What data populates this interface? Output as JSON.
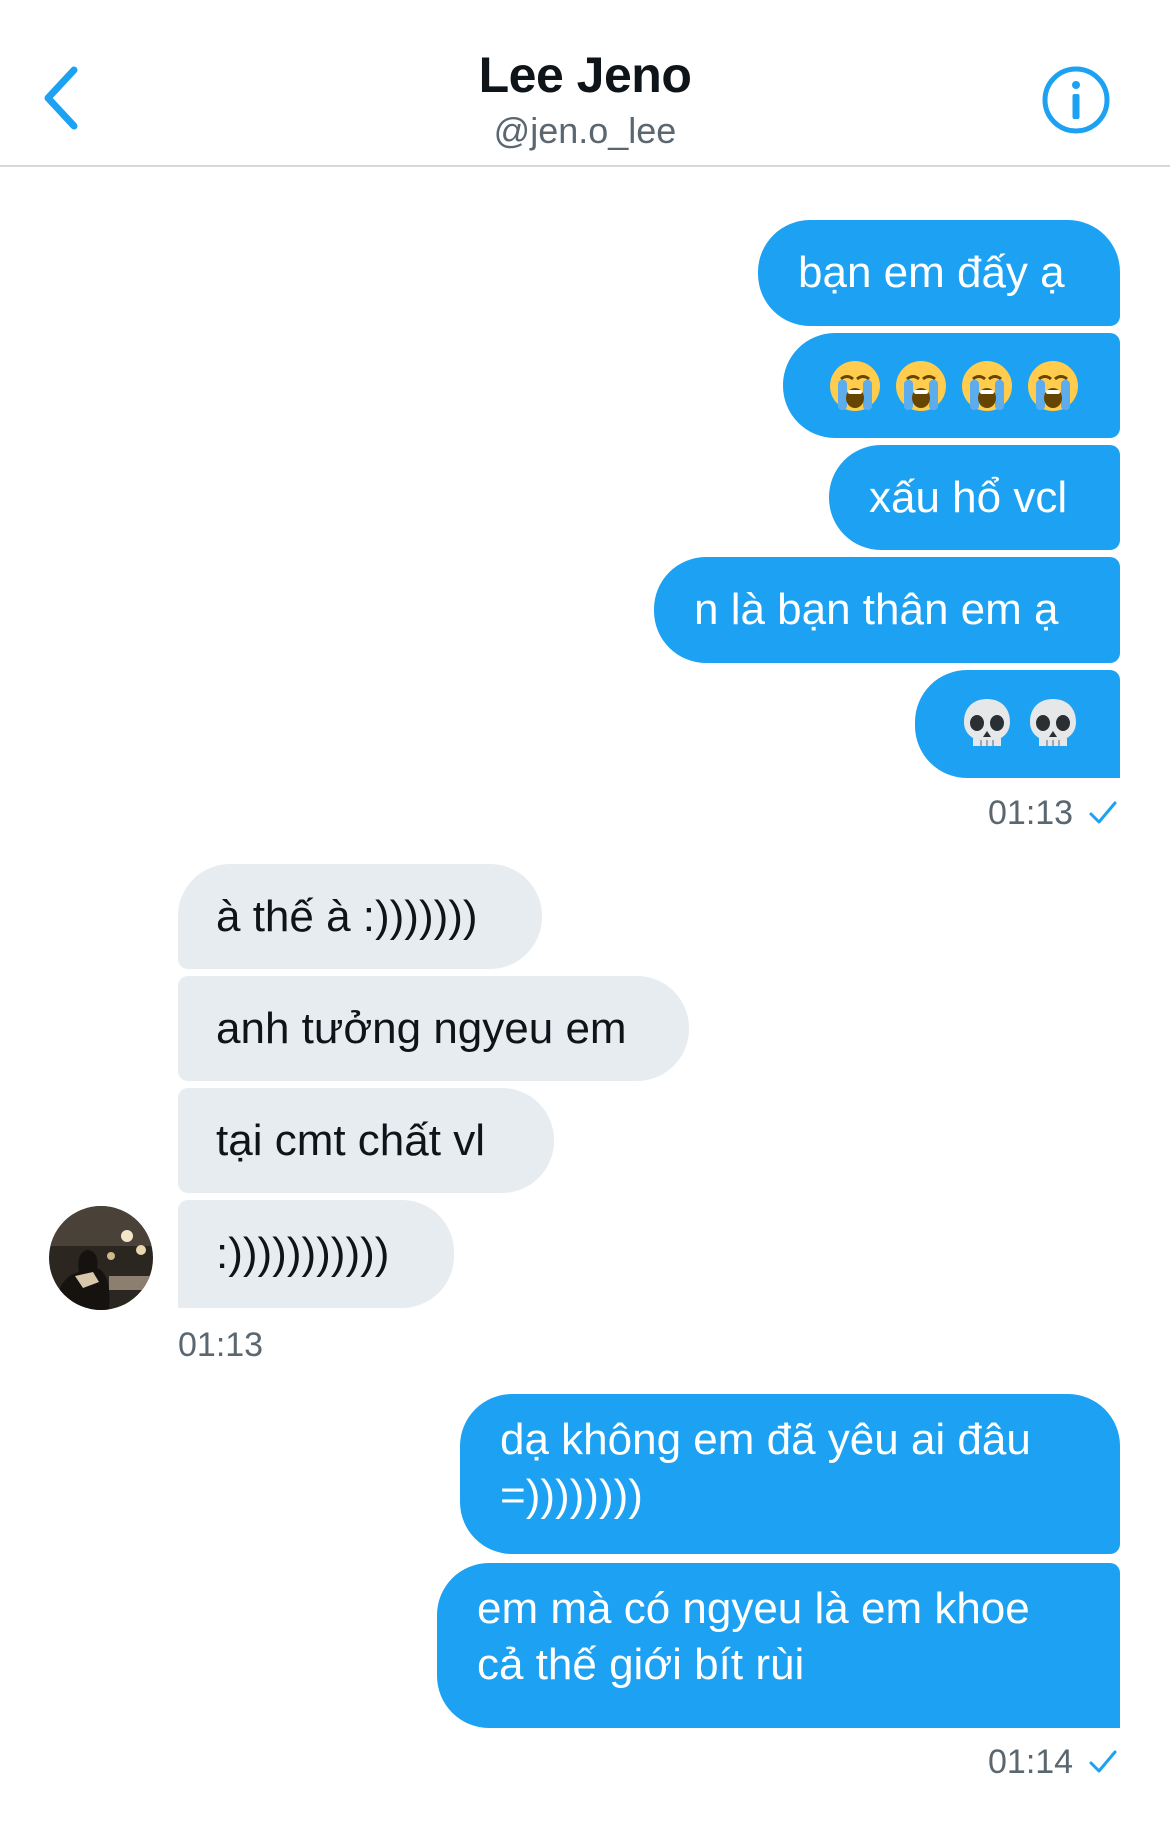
{
  "header": {
    "name": "Lee Jeno",
    "handle": "@jen.o_lee"
  },
  "colors": {
    "accent": "#1da1f2",
    "incoming_bubble": "#e6ecf0",
    "muted_text": "#5b6770"
  },
  "icons": {
    "back": "chevron-left-icon",
    "info": "info-icon",
    "sent": "checkmark-icon",
    "loudly_crying": "loudly-crying-face-emoji",
    "skull": "skull-emoji"
  },
  "group1": {
    "messages": [
      "bạn em đấy ạ",
      "😭😭😭😭",
      "xấu hổ vcl",
      "n là bạn thân em ạ",
      "💀💀"
    ],
    "time": "01:13"
  },
  "group2": {
    "messages": [
      "à thế à :)))))))",
      "anh tưởng ngyeu em",
      "tại cmt chất vl",
      ":)))))))))))"
    ],
    "time": "01:13"
  },
  "group3": {
    "messages": [
      "dạ không em đã yêu ai đâu =))))))))",
      "em mà có ngyeu là em khoe cả thế giới bít rùi"
    ],
    "time": "01:14"
  }
}
